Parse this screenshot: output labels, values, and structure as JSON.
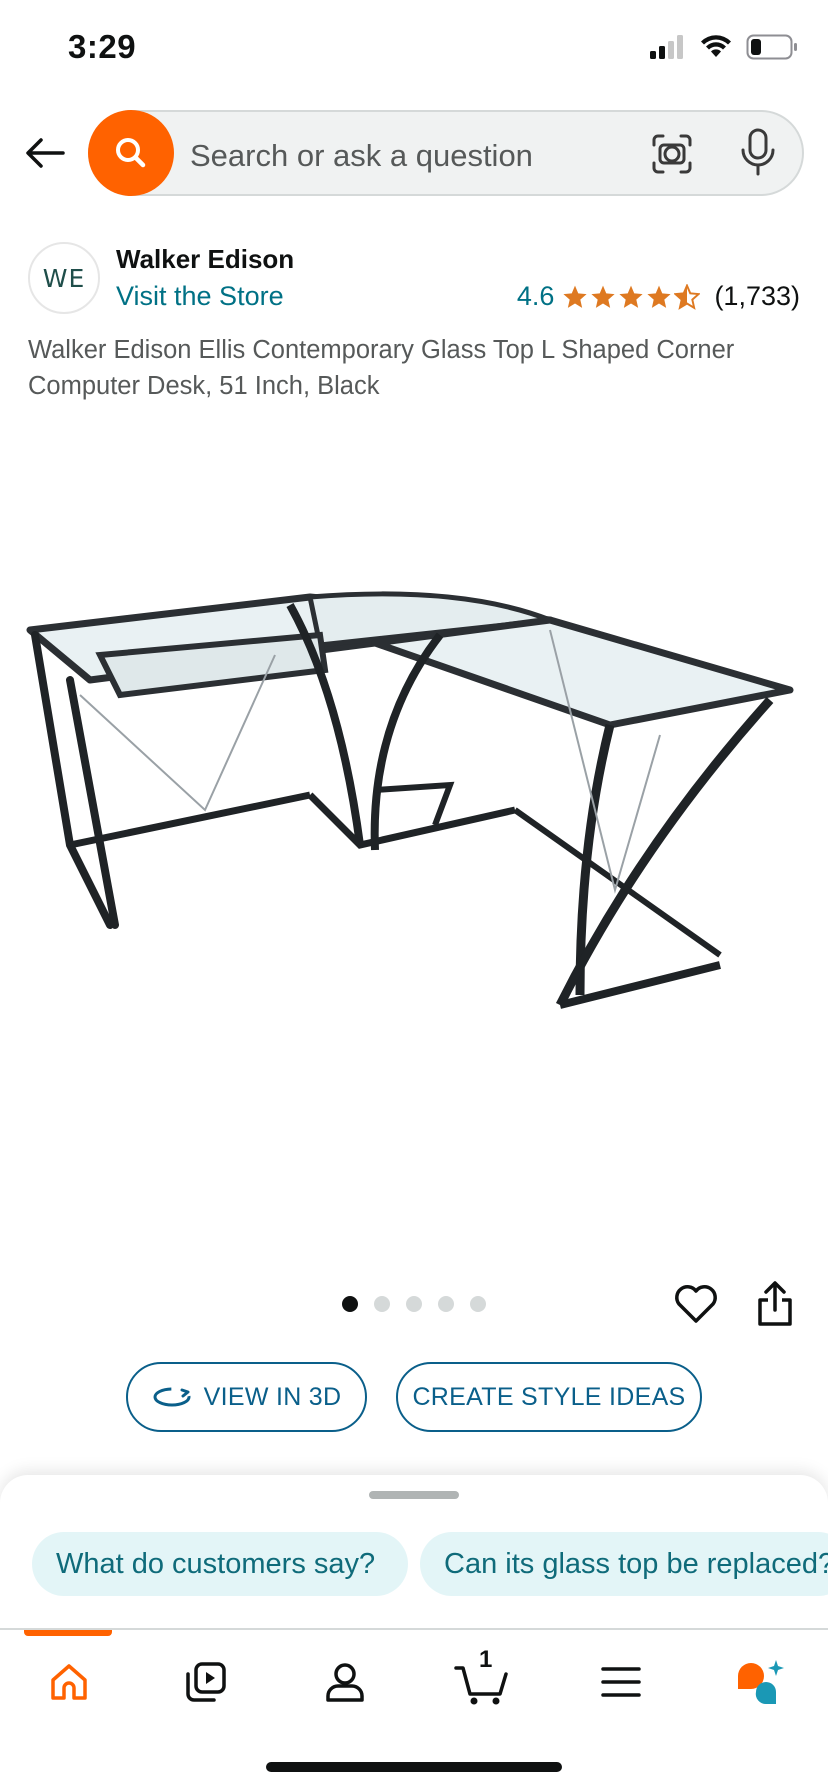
{
  "status_bar": {
    "time": "3:29"
  },
  "search": {
    "placeholder": "Search or ask a question"
  },
  "brand": {
    "logo_text": "WE",
    "name": "Walker Edison",
    "visit_store": "Visit the Store",
    "rating": "4.6",
    "rating_stars": 4.6,
    "review_count": "(1,733)"
  },
  "product": {
    "title": "Walker Edison Ellis Contemporary Glass Top L Shaped Corner Computer Desk, 51 Inch, Black",
    "image_count": 5,
    "active_image": 1
  },
  "actions": {
    "view_3d": "VIEW IN 3D",
    "style_ideas": "CREATE STYLE IDEAS"
  },
  "suggestions": [
    "What do customers say?",
    "Can its glass top be replaced?"
  ],
  "nav": {
    "cart_count": "1",
    "items": [
      "home-icon",
      "video-icon",
      "account-icon",
      "cart-icon",
      "menu-icon",
      "rufus-icon"
    ]
  },
  "colors": {
    "brand_orange": "#ff6200",
    "link_teal": "#007185",
    "star": "#de7921",
    "pill_blue": "#0a5f8a"
  }
}
